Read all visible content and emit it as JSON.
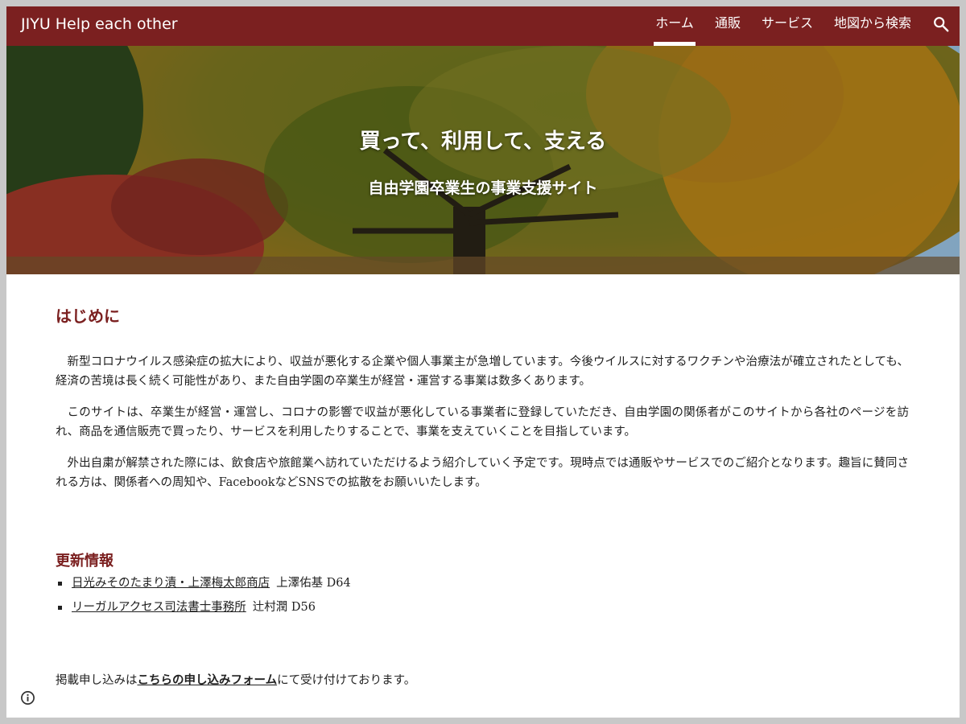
{
  "header": {
    "site_title": "JIYU Help each other",
    "nav": [
      {
        "label": "ホーム",
        "active": true
      },
      {
        "label": "通販",
        "active": false
      },
      {
        "label": "サービス",
        "active": false
      },
      {
        "label": "地図から検索",
        "active": false
      }
    ],
    "search_icon": "search-icon"
  },
  "hero": {
    "title": "買って、利用して、支える",
    "subtitle": "自由学園卒業生の事業支援サイト"
  },
  "intro": {
    "heading": "はじめに",
    "paragraphs": [
      "新型コロナウイルス感染症の拡大により、収益が悪化する企業や個人事業主が急増しています。今後ウイルスに対するワクチンや治療法が確立されたとしても、経済の苦境は長く続く可能性があり、また自由学園の卒業生が経営・運営する事業は数多くあります。",
      "このサイトは、卒業生が経営・運営し、コロナの影響で収益が悪化している事業者に登録していただき、自由学園の関係者がこのサイトから各社のページを訪れ、商品を通信販売で買ったり、サービスを利用したりすることで、事業を支えていくことを目指しています。",
      "外出自粛が解禁された際には、飲食店や旅館業へ訪れていただけるよう紹介していく予定です。現時点では通販やサービスでのご紹介となります。趣旨に賛同される方は、関係者への周知や、FacebookなどSNSでの拡散をお願いいたします。"
    ]
  },
  "updates": {
    "heading": "更新情報",
    "items": [
      {
        "link": "日光みそのたまり漬・上澤梅太郎商店",
        "author": "上澤佑基 D64"
      },
      {
        "link": "リーガルアクセス司法書士事務所",
        "author": "辻村潤 D56"
      }
    ]
  },
  "apply": {
    "prefix": "掲載申し込みは",
    "link": "こちらの申し込みフォーム",
    "suffix": "にて受け付けております。"
  },
  "colors": {
    "header_bg": "#7b2020",
    "heading": "#7b2020",
    "text": "#212121"
  }
}
